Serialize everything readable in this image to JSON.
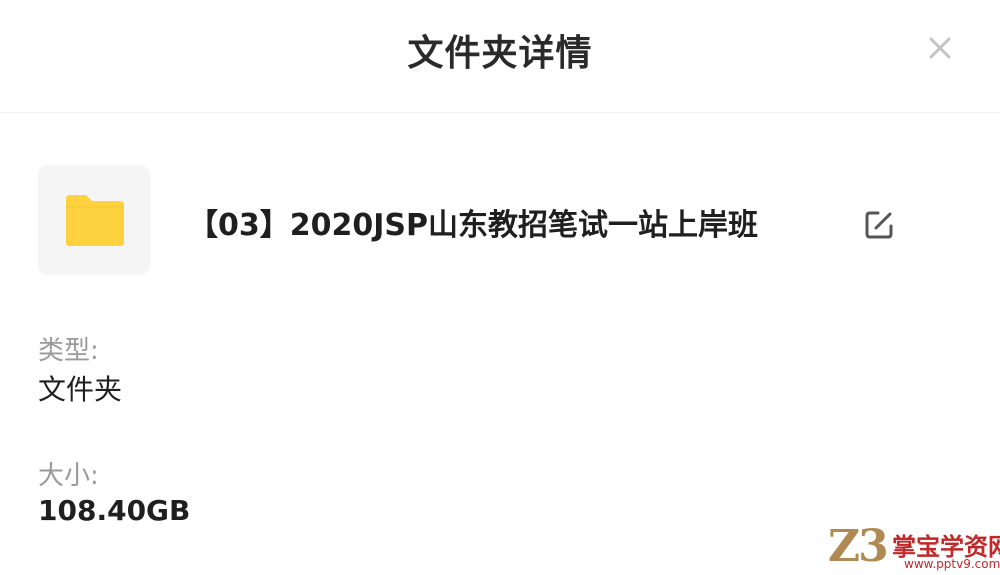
{
  "dialog": {
    "title": "文件夹详情",
    "close_icon": "close-icon"
  },
  "folder": {
    "icon": "folder-icon",
    "icon_color": "#fdd23e",
    "name": "【03】2020JSP山东教招笔试一站上岸班",
    "edit_icon": "edit-icon"
  },
  "details": {
    "type_label": "类型:",
    "type_value": "文件夹",
    "size_label": "大小:",
    "size_value": "108.40GB"
  },
  "watermark": {
    "mark": "Z3",
    "text": "掌宝学资网",
    "url": "www.pptv9.com"
  }
}
